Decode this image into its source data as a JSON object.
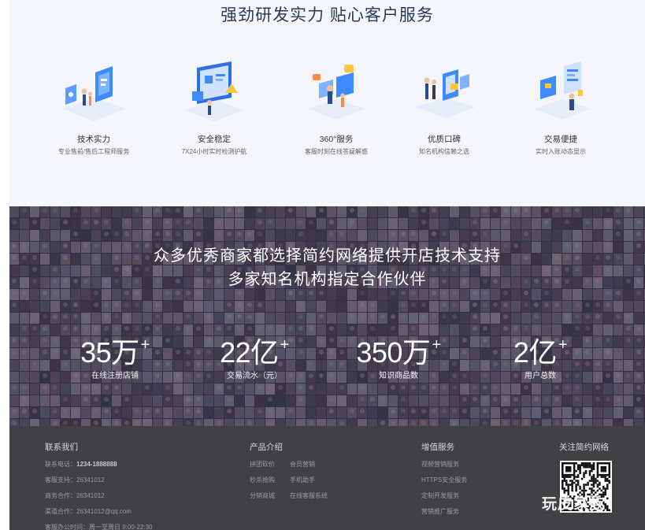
{
  "services": {
    "title": "强劲研发实力  贴心客户服务",
    "items": [
      {
        "icon": "tech-strength-illustration-icon",
        "title": "技术实力",
        "desc": "专业售前/售后工程师服务"
      },
      {
        "icon": "security-monitor-illustration-icon",
        "title": "安全稳定",
        "desc": "7X24小时实时检测护航"
      },
      {
        "icon": "customer-service-illustration-icon",
        "title": "360°服务",
        "desc": "客服时刻在线答疑解惑"
      },
      {
        "icon": "reputation-illustration-icon",
        "title": "优质口碑",
        "desc": "知名机构信赖之选"
      },
      {
        "icon": "transaction-illustration-icon",
        "title": "交易便捷",
        "desc": "实时入账动态显示"
      }
    ]
  },
  "partners": {
    "headline_1": "众多优秀商家都选择简约网络提供开店技术支持",
    "headline_2": "多家知名机构指定合作伙伴",
    "stats": [
      {
        "value": "35万",
        "suffix": "+",
        "label": "在线注册店铺"
      },
      {
        "value": "22亿",
        "suffix": "+",
        "label": "交易流水（元）"
      },
      {
        "value": "350万",
        "suffix": "+",
        "label": "知识商品数"
      },
      {
        "value": "2亿",
        "suffix": "+",
        "label": "用户总数"
      }
    ]
  },
  "footer": {
    "contact": {
      "title": "联系我们",
      "phone_label": "联系电话：",
      "phone": "1234-1888888",
      "support_label": "客服支持：",
      "support": "26341012",
      "business_label": "商务合作：",
      "business": "26341012",
      "channel_label": "渠道合作：",
      "channel": "26341012@qq.com",
      "hours": "客服办公时间：周一至周日 9:00-22:30"
    },
    "products": {
      "title": "产品介绍",
      "links": [
        "拼团砍价",
        "会员营销",
        "秒杀抢购",
        "手机助手",
        "分销商城",
        "在线客服系统"
      ]
    },
    "value_added": {
      "title": "增值服务",
      "links": [
        "视频营销服务",
        "HTTPS安全服务",
        "定制开发服务",
        "营销推广服务"
      ]
    },
    "follow": {
      "title": "关注简约网络",
      "watermark": "玩皮家族"
    }
  },
  "colors": {
    "services_bg": "#f5f6fb",
    "title_color": "#2a3a5a",
    "partners_overlay": "#2c2a44",
    "footer_bg": "#404045",
    "accent_blue": "#3d8bff"
  }
}
